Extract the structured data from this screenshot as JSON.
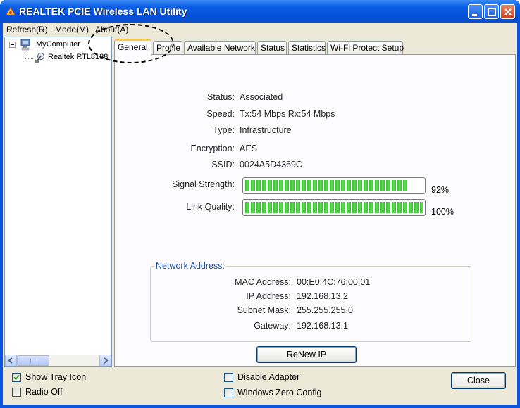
{
  "window": {
    "title": "REALTEK PCIE Wireless LAN Utility"
  },
  "menu": {
    "refresh": "Refresh(R)",
    "mode": "Mode(M)",
    "about": "About(A)"
  },
  "tree": {
    "root": "MyComputer",
    "adapter": "Realtek RTL8188"
  },
  "tabs": [
    "General",
    "Profile",
    "Available Network",
    "Status",
    "Statistics",
    "Wi-Fi Protect Setup"
  ],
  "general": {
    "status_label": "Status:",
    "status_value": "Associated",
    "speed_label": "Speed:",
    "speed_value": "Tx:54 Mbps Rx:54 Mbps",
    "type_label": "Type:",
    "type_value": "Infrastructure",
    "encryption_label": "Encryption:",
    "encryption_value": "AES",
    "ssid_label": "SSID:",
    "ssid_value": "0024A5D4369C",
    "signal_label": "Signal Strength:",
    "signal_percent": 92,
    "signal_text": "92%",
    "link_label": "Link Quality:",
    "link_percent": 100,
    "link_text": "100%"
  },
  "network_address": {
    "legend": "Network Address:",
    "mac_label": "MAC Address:",
    "mac_value": "00:E0:4C:76:00:01",
    "ip_label": "IP Address:",
    "ip_value": "192.168.13.2",
    "mask_label": "Subnet Mask:",
    "mask_value": "255.255.255.0",
    "gateway_label": "Gateway:",
    "gateway_value": "192.168.13.1"
  },
  "buttons": {
    "renew": "ReNew IP",
    "close": "Close"
  },
  "options": {
    "show_tray_icon": {
      "label": "Show Tray Icon",
      "checked": true
    },
    "radio_off": {
      "label": "Radio Off",
      "checked": false
    },
    "disable_adapter": {
      "label": "Disable Adapter",
      "checked": false
    },
    "windows_zero_config": {
      "label": "Windows Zero Config",
      "checked": false
    }
  },
  "colors": {
    "titlebar": "#0a5fe6",
    "meter_green": "#2fbd2f",
    "group_legend": "#1c4fa5",
    "active_tab_accent": "#ffc83c"
  }
}
